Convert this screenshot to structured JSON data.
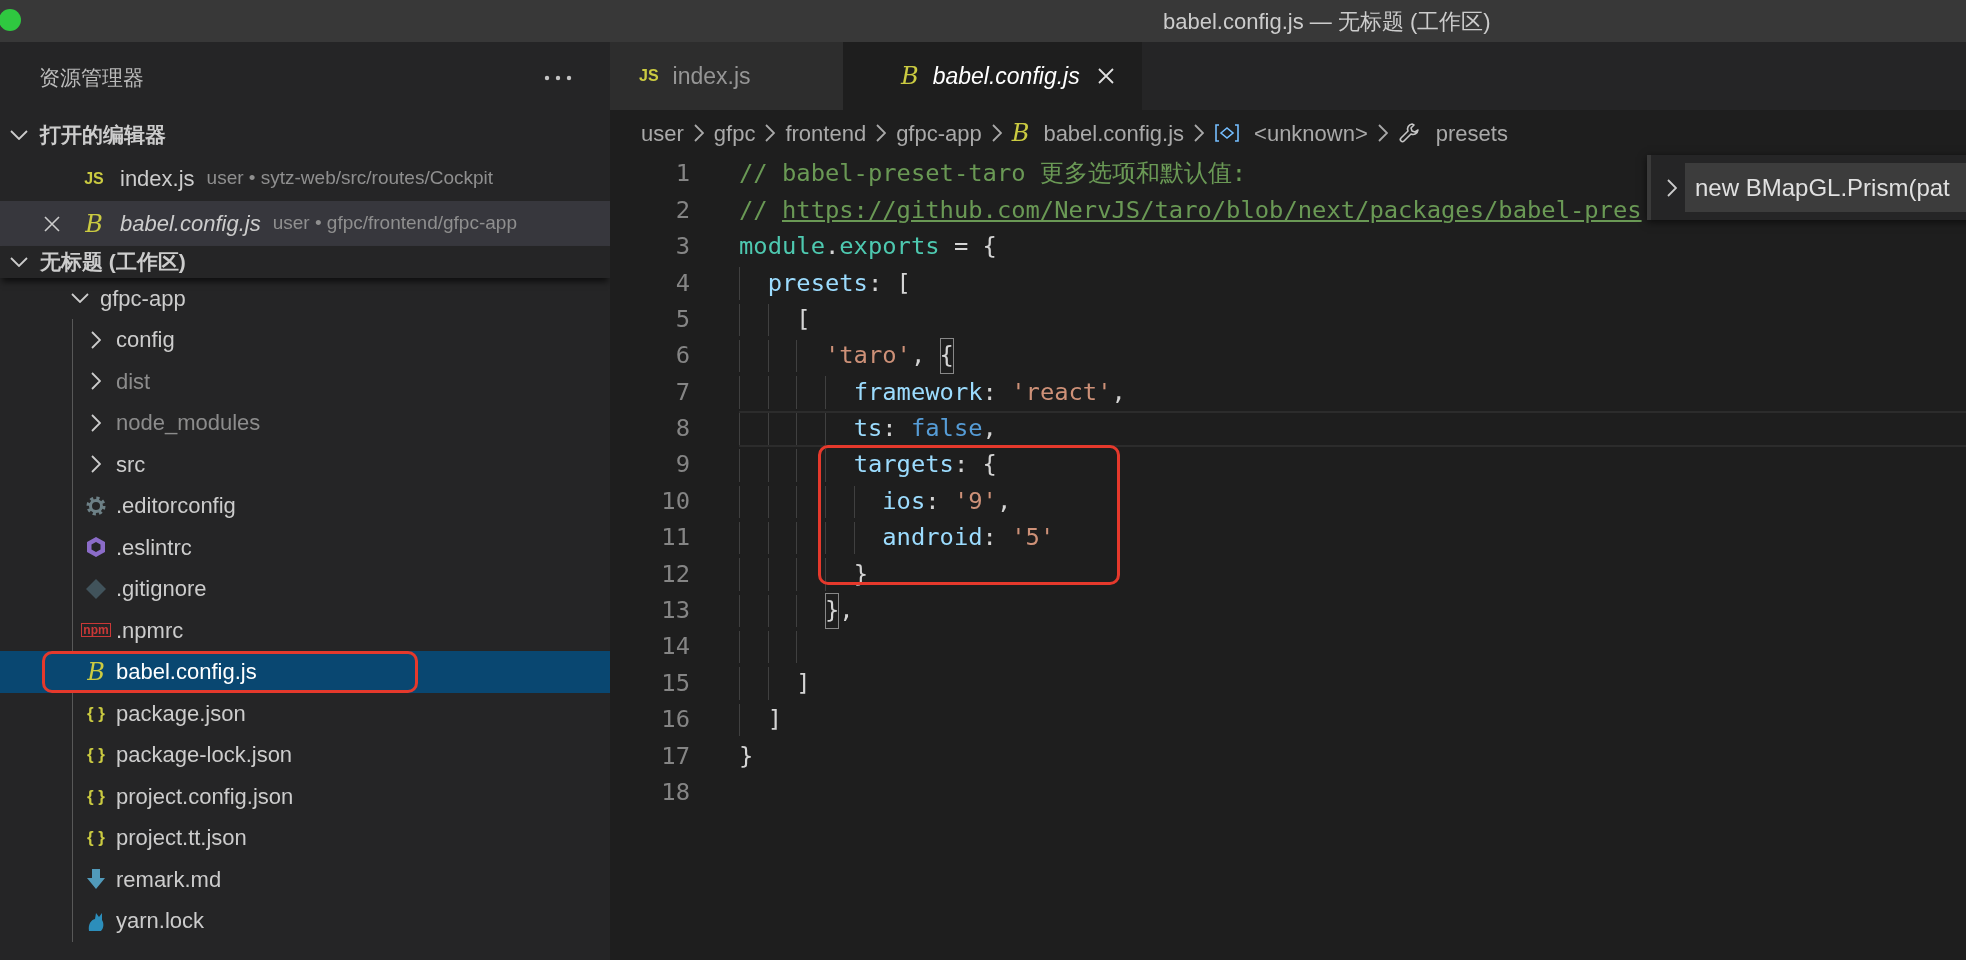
{
  "window": {
    "title": "babel.config.js — 无标题 (工作区)"
  },
  "sidebar": {
    "title": "资源管理器",
    "open_editors": {
      "title": "打开的编辑器",
      "expanded": true,
      "items": [
        {
          "name": "index.js",
          "description": "user • sytz-web/src/routes/Cockpit",
          "kind": "js",
          "icon_label": "JS",
          "selected": false,
          "preview": false
        },
        {
          "name": "babel.config.js",
          "description": "user • gfpc/frontend/gfpc-app",
          "kind": "babel",
          "icon_label": "B",
          "selected": true,
          "preview": true
        }
      ]
    },
    "workspace": {
      "title": "无标题 (工作区)",
      "expanded": true,
      "tree": [
        {
          "name": "gfpc-app",
          "kind": "folder",
          "expanded": true,
          "selected": false,
          "dimmed": false,
          "children": [
            {
              "name": "config",
              "kind": "folder",
              "expanded": false,
              "selected": false,
              "dimmed": false
            },
            {
              "name": "dist",
              "kind": "folder",
              "expanded": false,
              "selected": false,
              "dimmed": true
            },
            {
              "name": "node_modules",
              "kind": "folder",
              "expanded": false,
              "selected": false,
              "dimmed": true
            },
            {
              "name": "src",
              "kind": "folder",
              "expanded": false,
              "selected": false,
              "dimmed": false
            },
            {
              "name": ".editorconfig",
              "kind": "gear",
              "selected": false,
              "dimmed": false
            },
            {
              "name": ".eslintrc",
              "kind": "hexagon",
              "selected": false,
              "dimmed": false
            },
            {
              "name": ".gitignore",
              "kind": "diamond",
              "selected": false,
              "dimmed": false
            },
            {
              "name": ".npmrc",
              "kind": "npm",
              "icon_label": "npm",
              "selected": false,
              "dimmed": false
            },
            {
              "name": "babel.config.js",
              "kind": "babel",
              "icon_label": "B",
              "selected": true,
              "dimmed": false,
              "annotated": true
            },
            {
              "name": "package.json",
              "kind": "json",
              "icon_label": "{ }",
              "selected": false,
              "dimmed": false
            },
            {
              "name": "package-lock.json",
              "kind": "json",
              "icon_label": "{ }",
              "selected": false,
              "dimmed": false
            },
            {
              "name": "project.config.json",
              "kind": "json",
              "icon_label": "{ }",
              "selected": false,
              "dimmed": false
            },
            {
              "name": "project.tt.json",
              "kind": "json",
              "icon_label": "{ }",
              "selected": false,
              "dimmed": false
            },
            {
              "name": "remark.md",
              "kind": "arrow",
              "selected": false,
              "dimmed": false
            },
            {
              "name": "yarn.lock",
              "kind": "cat",
              "selected": false,
              "dimmed": false
            }
          ]
        }
      ]
    }
  },
  "editor": {
    "tabs": [
      {
        "label": "index.js",
        "kind": "js",
        "icon_label": "JS",
        "selected": false,
        "preview": false
      },
      {
        "label": "babel.config.js",
        "kind": "babel",
        "icon_label": "B",
        "selected": true,
        "preview": true
      }
    ],
    "breadcrumbs": [
      {
        "text": "user"
      },
      {
        "text": "gfpc"
      },
      {
        "text": "frontend"
      },
      {
        "text": "gfpc-app"
      },
      {
        "text": "babel.config.js",
        "kind": "babel",
        "icon_label": "B"
      },
      {
        "text": "<unknown>",
        "kind": "symbol"
      },
      {
        "text": "presets",
        "kind": "wrench"
      }
    ],
    "lines": [
      {
        "number": "1",
        "tokens": [
          {
            "kind": "comment",
            "text": "// babel-preset-taro 更多选项和默认值:"
          }
        ]
      },
      {
        "number": "2",
        "tokens": [
          {
            "kind": "comment",
            "text": "// "
          },
          {
            "kind": "link",
            "text": "https://github.com/NervJS/taro/blob/next/packages/babel-pres"
          }
        ]
      },
      {
        "number": "3",
        "tokens": [
          {
            "kind": "variable",
            "text": "module"
          },
          {
            "kind": "punct",
            "text": "."
          },
          {
            "kind": "variable",
            "text": "exports"
          },
          {
            "kind": "punct",
            "text": " = {"
          }
        ]
      },
      {
        "number": "4",
        "tokens": [
          {
            "kind": "property",
            "text": "  presets"
          },
          {
            "kind": "punct",
            "text": ": ["
          }
        ]
      },
      {
        "number": "5",
        "tokens": [
          {
            "kind": "punct",
            "text": "    ["
          }
        ]
      },
      {
        "number": "6",
        "tokens": [
          {
            "kind": "string",
            "text": "      'taro'"
          },
          {
            "kind": "punct",
            "text": ", "
          },
          {
            "kind": "punct",
            "text": "{",
            "bracket_match": true
          }
        ]
      },
      {
        "number": "7",
        "tokens": [
          {
            "kind": "property",
            "text": "        framework"
          },
          {
            "kind": "punct",
            "text": ": "
          },
          {
            "kind": "string",
            "text": "'react'"
          },
          {
            "kind": "punct",
            "text": ","
          }
        ]
      },
      {
        "number": "8",
        "current": true,
        "tokens": [
          {
            "kind": "property",
            "text": "        ts"
          },
          {
            "kind": "punct",
            "text": ": "
          },
          {
            "kind": "keyword",
            "text": "false"
          },
          {
            "kind": "punct",
            "text": ","
          }
        ]
      },
      {
        "number": "9",
        "annotated": true,
        "tokens": [
          {
            "kind": "property",
            "text": "        targets"
          },
          {
            "kind": "punct",
            "text": ": {"
          }
        ]
      },
      {
        "number": "10",
        "annotated": true,
        "tokens": [
          {
            "kind": "property",
            "text": "          ios"
          },
          {
            "kind": "punct",
            "text": ": "
          },
          {
            "kind": "string",
            "text": "'9'"
          },
          {
            "kind": "punct",
            "text": ","
          }
        ]
      },
      {
        "number": "11",
        "annotated": true,
        "tokens": [
          {
            "kind": "property",
            "text": "          android"
          },
          {
            "kind": "punct",
            "text": ": "
          },
          {
            "kind": "string",
            "text": "'5'"
          }
        ]
      },
      {
        "number": "12",
        "annotated": true,
        "tokens": [
          {
            "kind": "punct",
            "text": "        }"
          }
        ]
      },
      {
        "number": "13",
        "tokens": [
          {
            "kind": "punct",
            "text": "      }",
            "bracket_match": true
          },
          {
            "kind": "punct",
            "text": ","
          }
        ]
      },
      {
        "number": "14"
      },
      {
        "number": "15",
        "tokens": [
          {
            "kind": "punct",
            "text": "    ]"
          }
        ]
      },
      {
        "number": "16",
        "tokens": [
          {
            "kind": "punct",
            "text": "  ]"
          }
        ]
      },
      {
        "number": "17",
        "tokens": [
          {
            "kind": "punct",
            "text": "}"
          }
        ]
      },
      {
        "number": "18"
      }
    ],
    "hover": {
      "text": "new BMapGL.Prism(pat"
    }
  }
}
